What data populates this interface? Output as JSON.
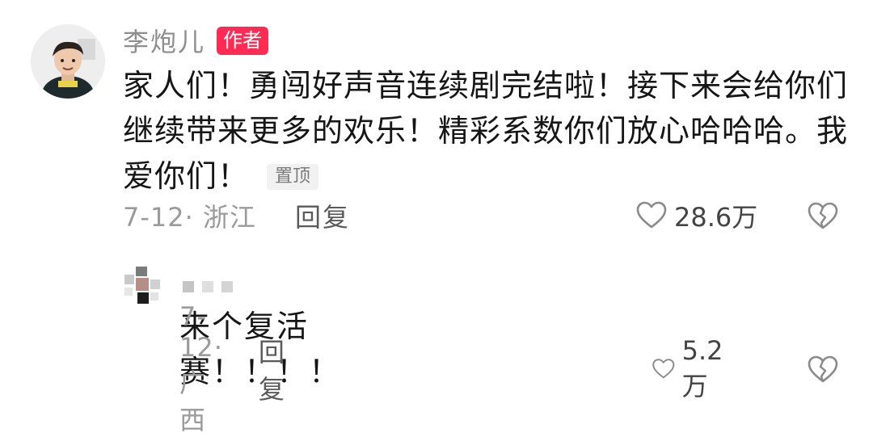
{
  "comment": {
    "author": "李炮儿",
    "badge": "作者",
    "text": "家人们！勇闯好声音连续剧完结啦！接下来会给你们继续带来更多的欢乐！精彩系数你们放心哈哈哈。我爱你们！",
    "pin_label": "置顶",
    "date_location": "7-12· 浙江",
    "reply_label": "回复",
    "like_count": "28.6万"
  },
  "reply": {
    "author": "",
    "text": "来个复活赛！！！！",
    "date_location": "7-12· 广西",
    "reply_label": "回复",
    "like_count": "5.2万"
  },
  "colors": {
    "badge_bg": "#fe2c55",
    "meta_text": "#9a9a9a",
    "name_text": "#8e8e8e"
  }
}
